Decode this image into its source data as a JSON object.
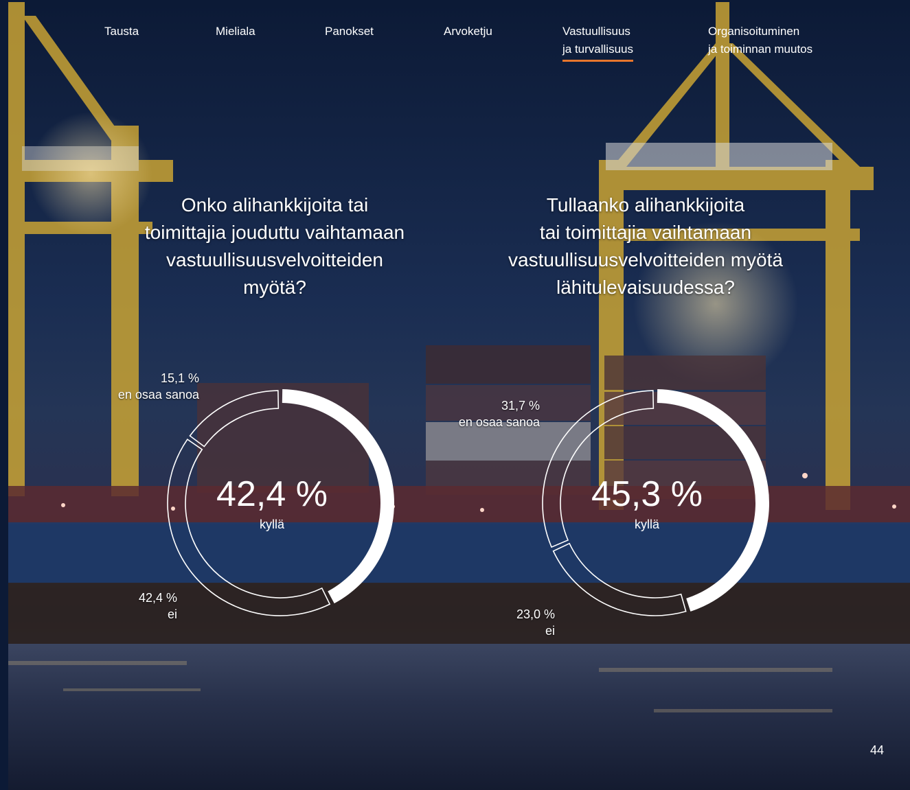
{
  "nav": {
    "items": [
      {
        "lines": [
          "Tausta"
        ],
        "active": false
      },
      {
        "lines": [
          "Mieliala"
        ],
        "active": false
      },
      {
        "lines": [
          "Panokset"
        ],
        "active": false
      },
      {
        "lines": [
          "Arvoketju"
        ],
        "active": false
      },
      {
        "lines": [
          "Vastuullisuus",
          "ja turvallisuus"
        ],
        "active": true
      },
      {
        "lines": [
          "Organisoituminen",
          "ja toiminnan muutos"
        ],
        "active": false
      }
    ],
    "active_color": "#e8762c"
  },
  "page_number": "44",
  "chart_data": [
    {
      "type": "pie",
      "title_lines": [
        "Onko alihankkijoita tai",
        "toimittajia jouduttu vaihtamaan",
        "vastuullisuusvelvoitteiden",
        "myötä?"
      ],
      "highlight": {
        "value_text": "42,4 %",
        "label": "kyllä"
      },
      "slices": [
        {
          "label": "kyllä",
          "value": 42.4,
          "value_text": "42,4 %",
          "style": "solid"
        },
        {
          "label": "ei",
          "value": 42.4,
          "value_text": "42,4 %",
          "style": "outline"
        },
        {
          "label": "en osaa sanoa",
          "value": 15.1,
          "value_text": "15,1 %",
          "style": "outline"
        }
      ]
    },
    {
      "type": "pie",
      "title_lines": [
        "Tullaanko alihankkijoita",
        "tai toimittajia vaihtamaan",
        "vastuullisuusvelvoitteiden myötä",
        "lähitulevaisuudessa?"
      ],
      "highlight": {
        "value_text": "45,3 %",
        "label": "kyllä"
      },
      "slices": [
        {
          "label": "kyllä",
          "value": 45.3,
          "value_text": "45,3 %",
          "style": "solid"
        },
        {
          "label": "ei",
          "value": 23.0,
          "value_text": "23,0 %",
          "style": "outline"
        },
        {
          "label": "en osaa sanoa",
          "value": 31.7,
          "value_text": "31,7 %",
          "style": "outline"
        }
      ]
    }
  ]
}
